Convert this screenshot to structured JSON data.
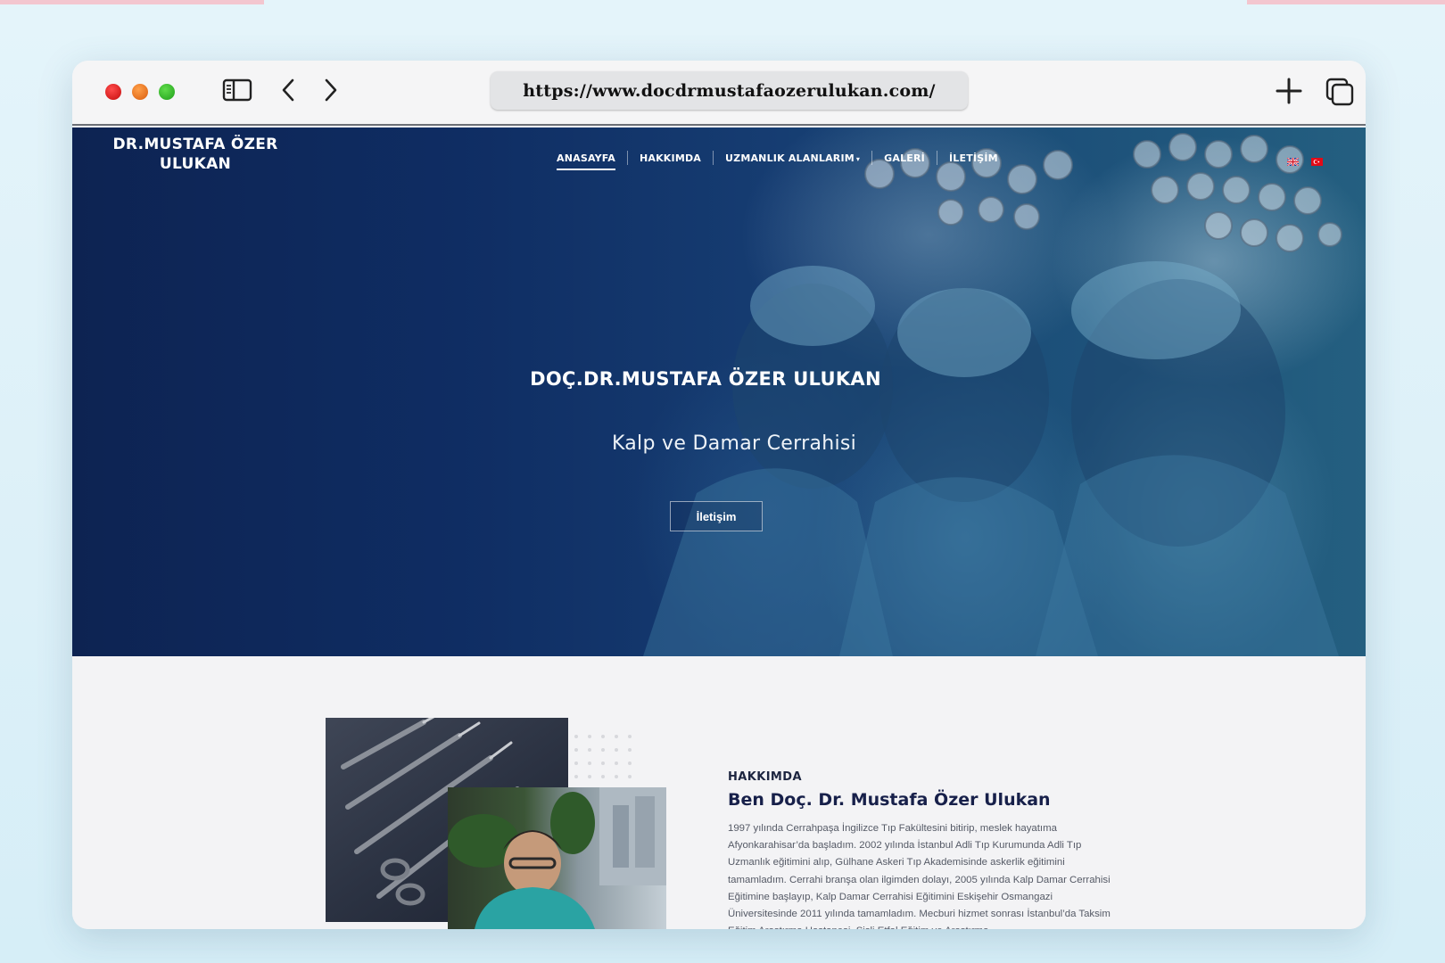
{
  "browser": {
    "url": "https://www.docdrmustafaozerulukan.com/",
    "icons": [
      "sidebar-icon",
      "back-icon",
      "forward-icon",
      "new-tab-icon",
      "tabs-overview-icon"
    ]
  },
  "site": {
    "brand": "DR.MUSTAFA ÖZER ULUKAN",
    "nav": [
      {
        "label": "ANASAYFA",
        "active": true
      },
      {
        "label": "HAKKIMDA"
      },
      {
        "label": "UZMANLIK ALANLARIM",
        "dropdown": true
      },
      {
        "label": "GALERİ"
      },
      {
        "label": "İLETİŞİM"
      }
    ],
    "languages": [
      "english-flag-icon",
      "turkish-flag-icon"
    ]
  },
  "hero": {
    "title": "DOÇ.DR.MUSTAFA ÖZER ULUKAN",
    "subtitle": "Kalp ve Damar Cerrahisi",
    "button": "İletişim"
  },
  "about": {
    "label": "HAKKIMDA",
    "heading": "Ben Doç. Dr. Mustafa Özer Ulukan",
    "body": "1997 yılında Cerrahpaşa İngilizce Tıp Fakültesini bitirip, meslek hayatıma Afyonkarahisar’da başladım. 2002 yılında İstanbul Adli Tıp Kurumunda Adli Tıp Uzmanlık eğitimini alıp, Gülhane Askeri Tıp Akademisinde askerlik eğitimini tamamladım. Cerrahi branşa olan ilgimden dolayı, 2005 yılında Kalp Damar Cerrahisi Eğitimine başlayıp,  Kalp Damar Cerrahisi Eğitimini Eskişehir Osmangazi Üniversitesinde 2011 yılında tamamladım. Mecburi hizmet sonrası İstanbul’da Taksim Eğitim Araştırma Hastanesi, Şişli Etfal Eğitim ve Araştırma"
  },
  "colors": {
    "hero_navy": "#0f2d63",
    "heading_navy": "#17204a",
    "body_gray": "#555a66"
  }
}
